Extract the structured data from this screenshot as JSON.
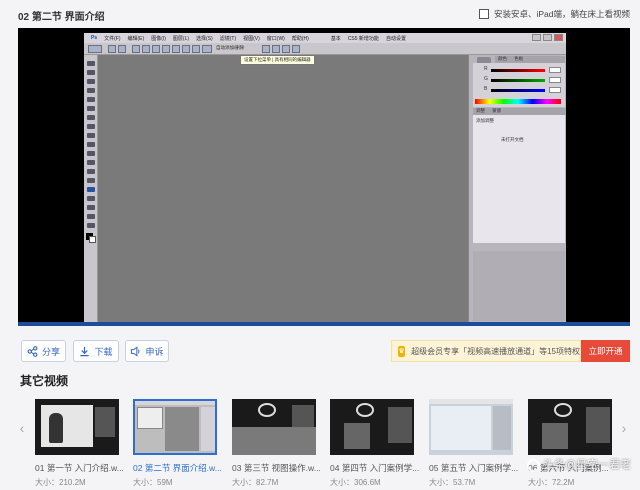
{
  "header": {
    "title": "02 第二节 界面介绍",
    "ipad_toggle_label": "安装安卓、iPad端，躺在床上看视频"
  },
  "player": {
    "screen": {
      "menus": [
        "文件(F)",
        "编辑(E)",
        "图像(I)",
        "图层(L)",
        "选择(S)",
        "滤镜(T)",
        "视图(V)",
        "窗口(W)",
        "帮助(H)"
      ],
      "menubar_right": [
        "基本",
        "CS5 新增功能",
        "自动设置"
      ],
      "option_label": "自动添加/删除",
      "tooltip": "设置下拉菜单 | 具有相同的编辑器",
      "panel_tabs": [
        "颜色",
        "色板"
      ],
      "color_channels": [
        "R",
        "G",
        "B"
      ],
      "adjust_tabs": [
        "调整",
        "蒙版"
      ],
      "adjust_title": "添加调整",
      "adjust_note": "未打开文档"
    }
  },
  "actions": {
    "share": "分享",
    "download": "下载",
    "report": "申诉",
    "vip_text": "超级会员专享「视频高速播放通道」等15项特权",
    "vip_button": "立即开通"
  },
  "more_videos": {
    "title": "其它视频",
    "items": [
      {
        "label": "01 第一节 入门介绍.w...",
        "size": "大小：210.2M"
      },
      {
        "label": "02 第二节 界面介绍.w...",
        "size": "大小：59M"
      },
      {
        "label": "03 第三节 视图操作.w...",
        "size": "大小：82.7M"
      },
      {
        "label": "04 第四节 入门案例学...",
        "size": "大小：306.6M"
      },
      {
        "label": "05 第五节 入门案例学...",
        "size": "大小：53.7M"
      },
      {
        "label": "06 第六节 入门案例...",
        "size": "大小：72.2M"
      }
    ]
  },
  "watermark": "头条@星空一君老"
}
